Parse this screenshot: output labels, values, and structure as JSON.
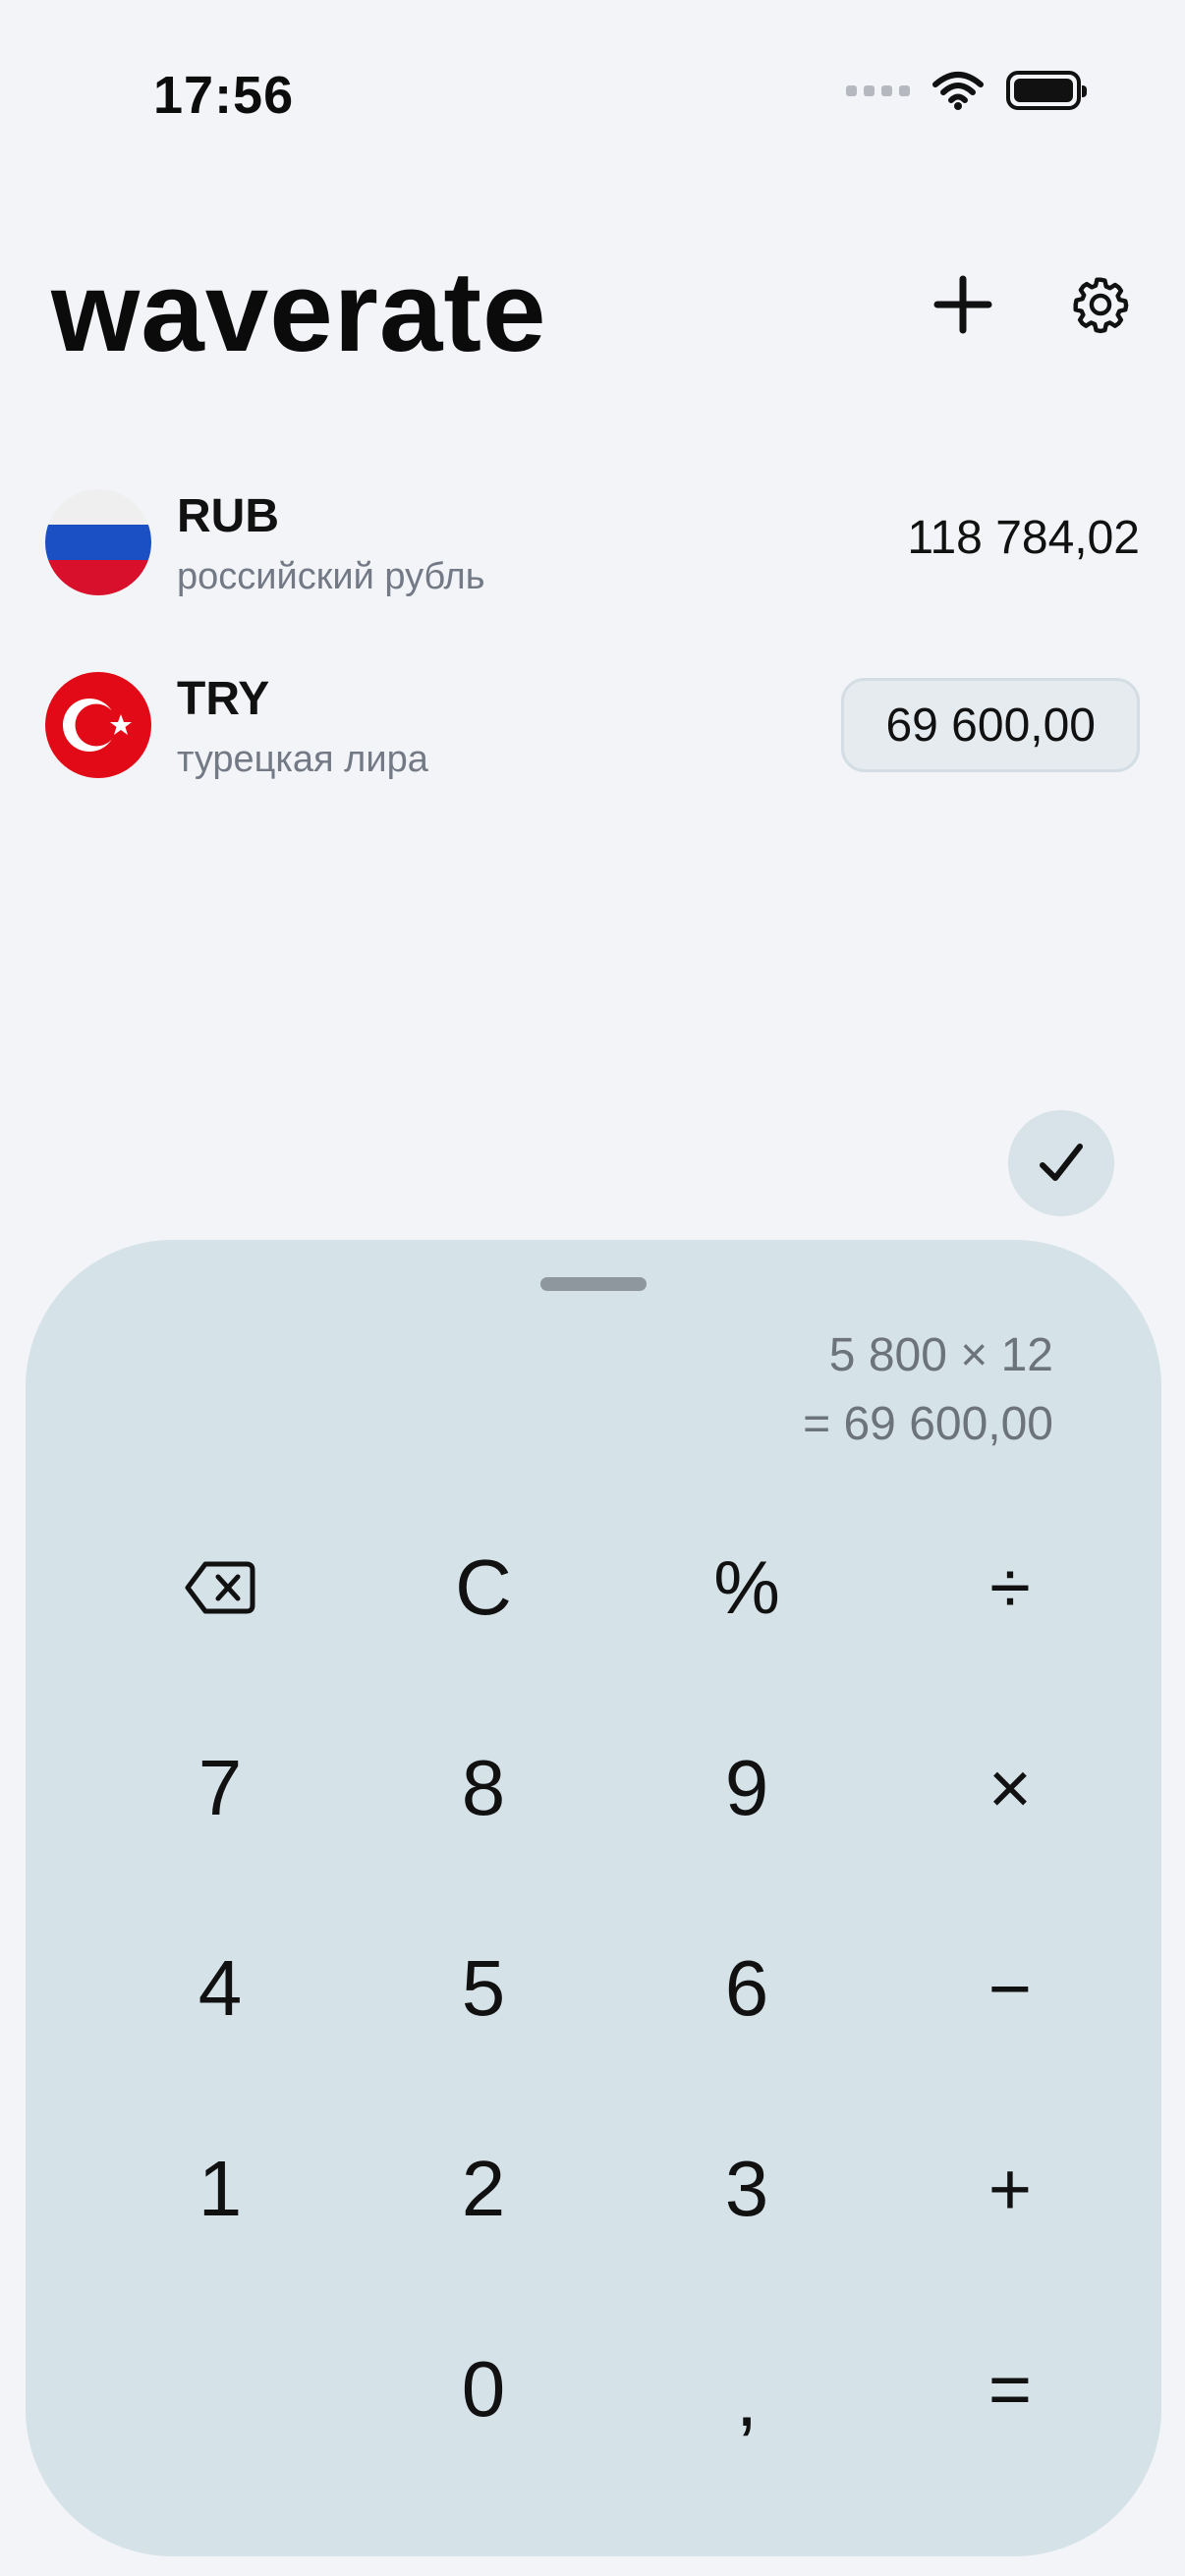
{
  "status_bar": {
    "time": "17:56",
    "signal_icon": "cellular-dots-icon",
    "wifi_icon": "wifi-icon",
    "battery_icon": "battery-full-icon"
  },
  "header": {
    "title": "waverate",
    "add_icon": "plus-icon",
    "settings_icon": "gear-icon"
  },
  "currencies": [
    {
      "code": "RUB",
      "name": "российский рубль",
      "amount": "118 784,02",
      "flag_icon": "russia-flag-icon",
      "active": false
    },
    {
      "code": "TRY",
      "name": "турецкая лира",
      "amount": "69 600,00",
      "flag_icon": "turkey-flag-icon",
      "active": true
    }
  ],
  "confirm": {
    "icon": "checkmark-icon"
  },
  "calculator": {
    "expression": "5 800 × 12",
    "result": "= 69 600,00",
    "keys": {
      "backspace_icon": "backspace-icon",
      "clear": "C",
      "percent": "%",
      "divide": "÷",
      "seven": "7",
      "eight": "8",
      "nine": "9",
      "multiply": "×",
      "four": "4",
      "five": "5",
      "six": "6",
      "minus": "−",
      "one": "1",
      "two": "2",
      "three": "3",
      "plus": "+",
      "zero": "0",
      "comma": ",",
      "equals": "="
    }
  },
  "colors": {
    "background": "#f2f4f8",
    "sheet": "#d5e2e8",
    "active_field": "#e5ebef",
    "secondary_text": "#737a86",
    "russia_red": "#d8102c",
    "russia_blue": "#1b4fc4",
    "turkey_red": "#e30a17"
  }
}
